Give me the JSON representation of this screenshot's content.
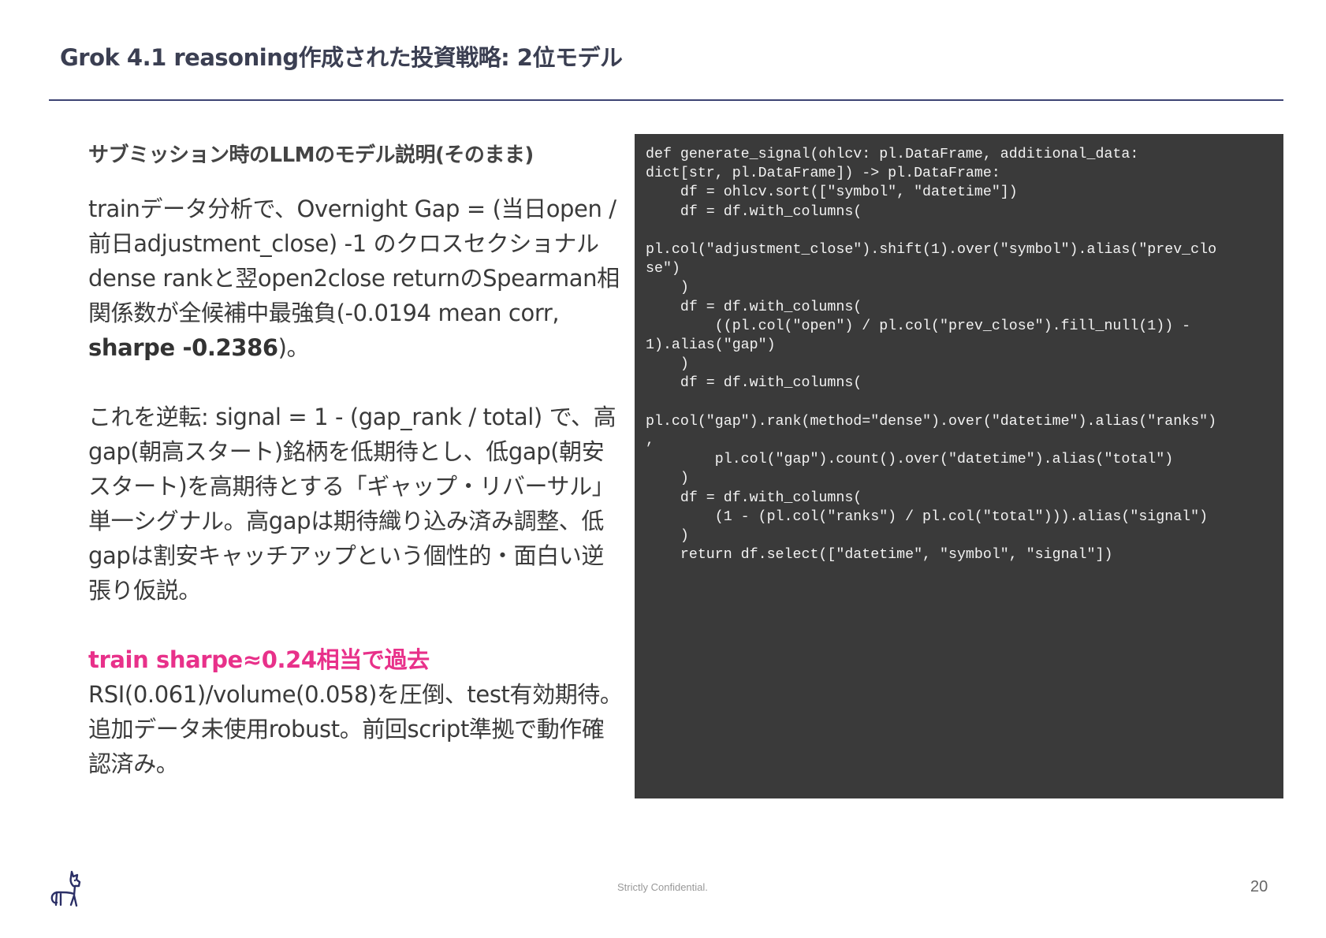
{
  "slide": {
    "title": "Grok 4.1 reasoning作成された投資戦略: 2位モデル",
    "section_heading": "サブミッション時のLLMのモデル説明(そのまま)",
    "paragraph1": {
      "text": "trainデータ分析で、Overnight Gap = (当日open / 前日adjustment_close) -1 のクロスセクショナルdense rankと翌open2close returnのSpearman相関係数が全候補中最強負(-0.0194 mean corr, ",
      "bold": "sharpe -0.2386",
      "tail": ")。"
    },
    "paragraph2": "これを逆転: signal = 1 - (gap_rank / total) で、高gap(朝高スタート)銘柄を低期待とし、低gap(朝安スタート)を高期待とする「ギャップ・リバーサル」単一シグナル。高gapは期待織り込み済み調整、低gapは割安キャッチアップという個性的・面白い逆張り仮説。",
    "paragraph3": {
      "highlight": "train sharpe≈0.24相当で過去",
      "text": "RSI(0.061)/volume(0.058)を圧倒、test有効期待。追加データ未使用robust。前回script準拠で動作確認済み。"
    },
    "code": "def generate_signal(ohlcv: pl.DataFrame, additional_data:\ndict[str, pl.DataFrame]) -> pl.DataFrame:\n    df = ohlcv.sort([\"symbol\", \"datetime\"])\n    df = df.with_columns(\n\npl.col(\"adjustment_close\").shift(1).over(\"symbol\").alias(\"prev_clo\nse\")\n    )\n    df = df.with_columns(\n        ((pl.col(\"open\") / pl.col(\"prev_close\").fill_null(1)) -\n1).alias(\"gap\")\n    )\n    df = df.with_columns(\n\npl.col(\"gap\").rank(method=\"dense\").over(\"datetime\").alias(\"ranks\")\n,\n        pl.col(\"gap\").count().over(\"datetime\").alias(\"total\")\n    )\n    df = df.with_columns(\n        (1 - (pl.col(\"ranks\") / pl.col(\"total\"))).alias(\"signal\")\n    )\n    return df.select([\"datetime\", \"symbol\", \"signal\"])",
    "footer": "Strictly Confidential.",
    "page_number": "20",
    "logo_icon": "llama-icon"
  },
  "colors": {
    "title": "#3b3f52",
    "rule": "#3d4373",
    "highlight": "#e8318a",
    "code_bg": "#3a3a3a",
    "code_text": "#f2f2f2"
  }
}
